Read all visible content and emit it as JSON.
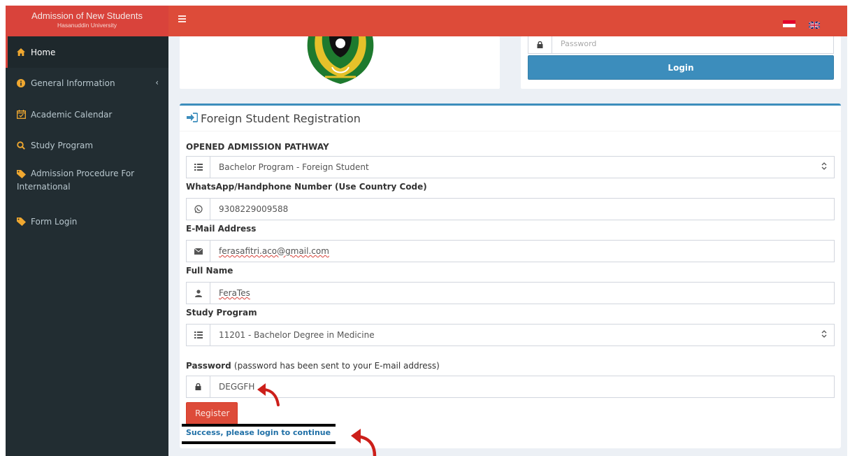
{
  "brand": {
    "title": "Admission of New Students",
    "subtitle": "Hasanuddin University"
  },
  "sidebar": {
    "items": [
      {
        "label": "Home",
        "icon": "home-icon"
      },
      {
        "label": "General Information",
        "icon": "info-circle-icon"
      },
      {
        "label": "Academic Calendar",
        "icon": "calendar-icon"
      },
      {
        "label": "Study Program",
        "icon": "search-icon"
      },
      {
        "label_line1": "Admission Procedure For",
        "label_line2": "International",
        "icon": "tag-icon"
      },
      {
        "label": "Form Login",
        "icon": "tag-icon"
      }
    ]
  },
  "login": {
    "password_placeholder": "Password",
    "button": "Login"
  },
  "registration": {
    "title": "Foreign Student Registration",
    "pathway_label": "OPENED ADMISSION PATHWAY",
    "pathway_value": "Bachelor Program - Foreign Student",
    "phone_label": "WhatsApp/Handphone Number (Use Country Code)",
    "phone_value": "9308229009588",
    "email_label": "E-Mail Address",
    "email_value": "ferasafitri.aco@gmail.com",
    "fullname_label": "Full Name",
    "fullname_value": "FeraTes",
    "study_label": "Study Program",
    "study_value": "11201 - Bachelor Degree in Medicine",
    "password_label_bold": "Password",
    "password_label_note": "(password has been sent to your E-mail address)",
    "password_value": "DEGGFH",
    "register_button": "Register",
    "success_message": "Success, please login to continue"
  },
  "colors": {
    "topbar": "#dd4b39",
    "sidebar": "#222d32",
    "primary": "#3c8dbc",
    "annotation_arrow": "#cc1f1a"
  }
}
